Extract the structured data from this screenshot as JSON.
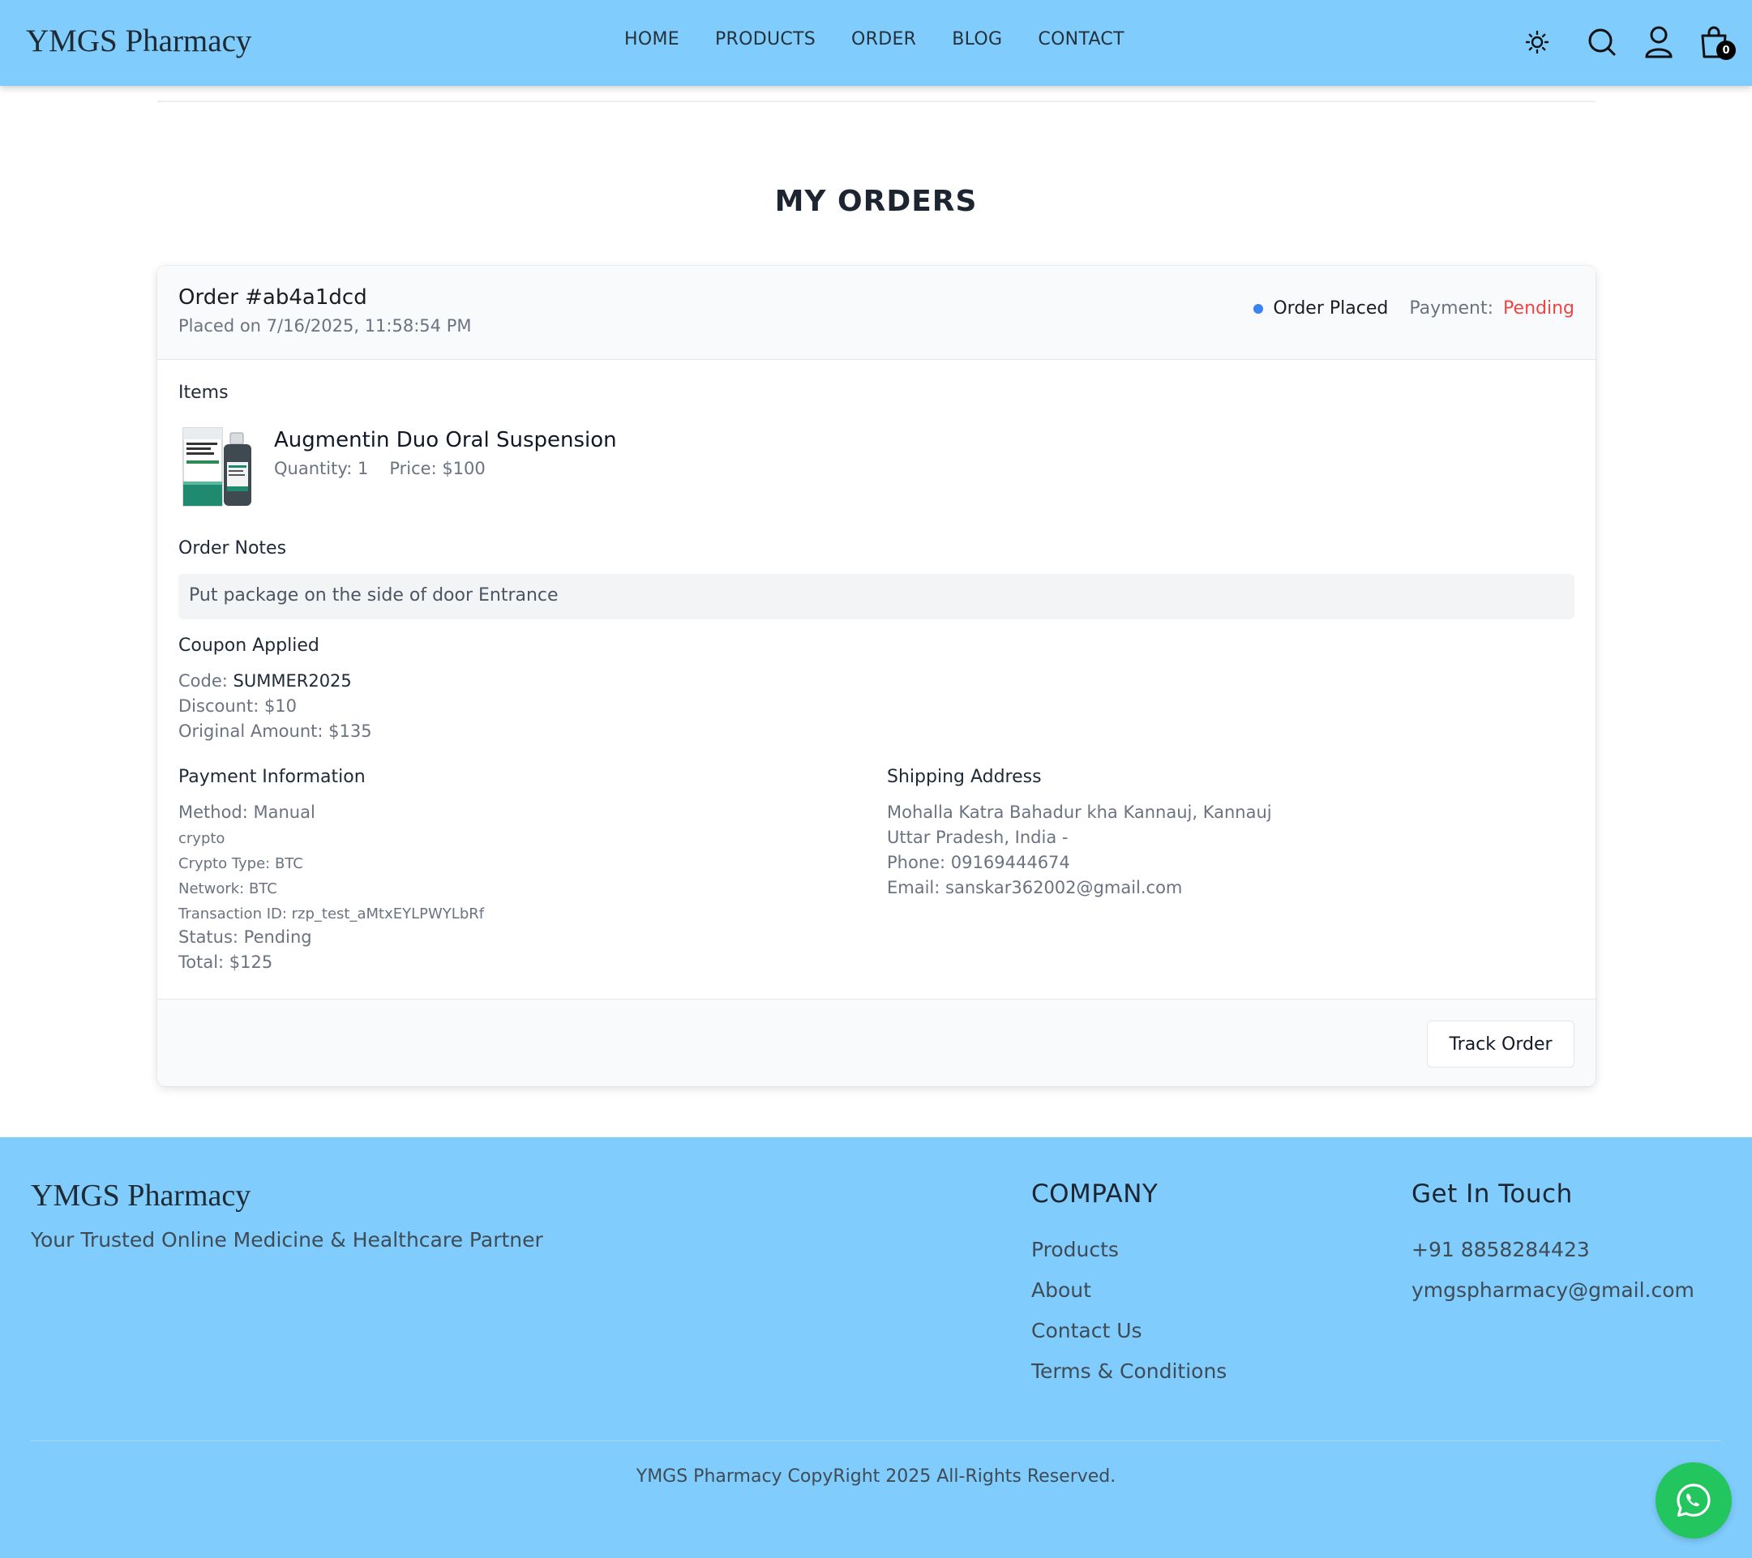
{
  "header": {
    "logo": "YMGS Pharmacy",
    "nav": [
      "HOME",
      "PRODUCTS",
      "ORDER",
      "BLOG",
      "CONTACT"
    ],
    "cart_count": "0",
    "icons": [
      "theme-toggle-icon",
      "search-icon",
      "user-icon",
      "cart-icon"
    ]
  },
  "page": {
    "title": "MY ORDERS"
  },
  "order": {
    "id": "Order #ab4a1dcd",
    "placed_on": "Placed on 7/16/2025, 11:58:54 PM",
    "status": "Order Placed",
    "payment_label": "Payment:",
    "payment_status": "Pending",
    "items_label": "Items",
    "items": [
      {
        "name": "Augmentin Duo Oral Suspension",
        "quantity": "Quantity: 1",
        "price": "Price: $100"
      }
    ],
    "notes_label": "Order Notes",
    "notes": "Put package on the side of door Entrance",
    "coupon": {
      "label": "Coupon Applied",
      "code_label": "Code:",
      "code": "SUMMER2025",
      "discount": "Discount: $10",
      "original": "Original Amount: $135"
    },
    "payment": {
      "label": "Payment Information",
      "method": "Method: Manual",
      "crypto": "crypto",
      "crypto_type": "Crypto Type: BTC",
      "network": "Network: BTC",
      "transaction": "Transaction ID: rzp_test_aMtxEYLPWYLbRf",
      "status": "Status: Pending",
      "total": "Total: $125"
    },
    "shipping": {
      "label": "Shipping Address",
      "line1": "Mohalla Katra Bahadur kha Kannauj, Kannauj",
      "line2": "Uttar Pradesh, India -",
      "phone": "Phone: 09169444674",
      "email": "Email: sanskar362002@gmail.com"
    },
    "track_label": "Track Order"
  },
  "footer": {
    "logo": "YMGS Pharmacy",
    "tagline": "Your Trusted Online Medicine & Healthcare Partner",
    "company_heading": "COMPANY",
    "company_links": [
      "Products",
      "About",
      "Contact Us",
      "Terms & Conditions"
    ],
    "contact_heading": "Get In Touch",
    "phone": "+91 8858284423",
    "email": "ymgspharmacy@gmail.com",
    "copyright": "YMGS Pharmacy CopyRight 2025 All-Rights Reserved."
  },
  "colors": {
    "header_bg": "#7fccfd",
    "status_dot": "#3b82f6",
    "pending": "#ef4444",
    "whatsapp": "#22c55e"
  }
}
